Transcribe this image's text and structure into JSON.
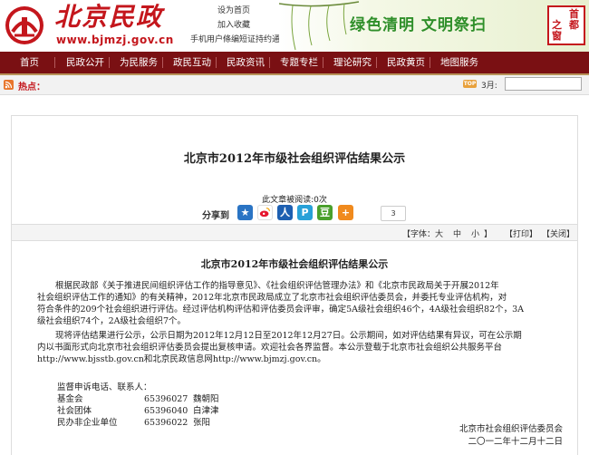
{
  "header": {
    "logo_cn": "北京民政",
    "logo_url": "www.bjmzj.gov.cn",
    "quick_links": [
      "设为首页",
      "加入收藏",
      "手机用户條编短证持约通道"
    ],
    "slogan": "绿色清明 文明祭扫",
    "seal_line1": "首都",
    "seal_line2": "之窗"
  },
  "nav": {
    "items": [
      "首页",
      "民政公开",
      "为民服务",
      "政民互动",
      "民政资讯",
      "专题专栏",
      "理论研究",
      "民政黄页",
      "地图服务"
    ]
  },
  "hotbar": {
    "label": "热点：",
    "top_badge": "TOP",
    "month_label": "3月:",
    "search_value": ""
  },
  "article": {
    "page_title": "北京市2012年市级社会组织评估结果公示",
    "view_count": "此文章被阅读:0次",
    "share_label": "分享到",
    "share_count": "3",
    "toolbar": {
      "font_label": "【字体：",
      "font_large": "大",
      "font_medium": "中",
      "font_small": "小",
      "font_close": "】",
      "print": "【打印】",
      "close": "【关闭】"
    },
    "title": "北京市2012年市级社会组织评估结果公示",
    "para1": [
      "根据民政部《关于推进民间组织评估工作的指导意见》、《社会组织评估管理办法》和《北京市民政局关于开展2012年",
      "社会组织评估工作的通知》的有关精神，2012年北京市民政局成立了北京市社会组织评估委员会，并委托专业评估机构，对",
      "符合条件的209个社会组织进行评估。经过评估机构评估和评估委员会评审，确定5A级社会组织46个，4A级社会组织82个，3A",
      "级社会组织74个，2A级社会组织7个。"
    ],
    "para2": [
      "现将评估结果进行公示，公示日期为2012年12月12日至2012年12月27日。公示期间，如对评估结果有异议，可在公示期",
      "内以书面形式向北京市社会组织评估委员会提出复核申请。欢迎社会各界监督。本公示登载于北京市社会组织公共服务平台",
      "http://www.bjsstb.gov.cn和北京民政信息网http://www.bjmzj.gov.cn。"
    ],
    "contact_heading": "监督申诉电话、联系人：",
    "contacts": [
      {
        "category": "基金会",
        "phone": "65396027",
        "name": "魏朝阳"
      },
      {
        "category": "社会团体",
        "phone": "65396040",
        "name": "白津津"
      },
      {
        "category": "民办非企业单位",
        "phone": "65396022",
        "name": "张阳"
      }
    ],
    "signature": "北京市社会组织评估委员会",
    "date": "二〇一二年十二月十二日"
  },
  "colors": {
    "brand_red": "#c4161c",
    "nav_bg": "#7a1013",
    "slogan_green": "#2f8f2a"
  }
}
